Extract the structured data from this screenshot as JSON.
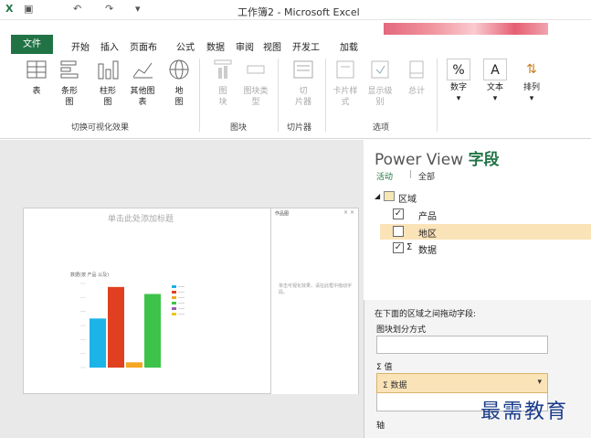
{
  "title": "工作簿2 - Microsoft Excel",
  "tabs": [
    "文件",
    "开始",
    "插入",
    "页面布",
    "公式",
    "数据",
    "审阅",
    "视图",
    "开发工",
    "加载"
  ],
  "ribbon": {
    "switch_group": {
      "label": "切换可视化效果",
      "buttons": [
        {
          "name": "table",
          "label": "表"
        },
        {
          "name": "bar",
          "label": "条形\n图"
        },
        {
          "name": "column",
          "label": "柱形\n图"
        },
        {
          "name": "other",
          "label": "其他图\n表"
        },
        {
          "name": "map",
          "label": "地\n图"
        }
      ]
    },
    "tiles_group": {
      "label": "图块",
      "buttons": [
        {
          "name": "tiles",
          "label": "图\n块"
        },
        {
          "name": "tile_type",
          "label": "图块类\n型"
        }
      ]
    },
    "slicer_group": {
      "label": "切片器",
      "buttons": [
        {
          "name": "slicer",
          "label": "切\n片器"
        }
      ]
    },
    "options_group": {
      "label": "选项",
      "buttons": [
        {
          "name": "card",
          "label": "卡片样\n式"
        },
        {
          "name": "show_level",
          "label": "显示级\n别"
        },
        {
          "name": "total",
          "label": "总计"
        }
      ]
    },
    "format_buttons": [
      {
        "name": "number",
        "icon": "%",
        "label": "数字"
      },
      {
        "name": "text",
        "icon": "A",
        "label": "文本"
      },
      {
        "name": "sort",
        "icon": "⇅",
        "label": "排列"
      }
    ]
  },
  "canvas": {
    "sheet_title_placeholder": "单击此处添加标题",
    "filters_title": "作品图",
    "filters_hint": "单击可视化效果，请在此框中拖动字段。",
    "chart_title": "数据(按 产品 以及)"
  },
  "chart_data": {
    "type": "bar",
    "categories": [
      "A",
      "B",
      "C",
      "D"
    ],
    "values": [
      1400,
      2300,
      150,
      2100
    ],
    "ylim": [
      0,
      2400
    ],
    "colors": [
      "#1bb3e8",
      "#e0401f",
      "#f5a623",
      "#3dc34a"
    ],
    "legend_colors": [
      "#1bb3e8",
      "#e0401f",
      "#f5a623",
      "#3dc34a",
      "#9b59b6",
      "#f1c40f"
    ]
  },
  "pane": {
    "title_a": "Power View ",
    "title_b": "字段",
    "tab_active": "活动",
    "tab_all": "全部",
    "table_name": "区域",
    "fields": [
      {
        "label": "产品",
        "checked": true,
        "sum": false
      },
      {
        "label": "地区",
        "checked": false,
        "sum": false
      },
      {
        "label": "数据",
        "checked": true,
        "sum": true
      }
    ],
    "drag_hint": "在下面的区域之间拖动字段:",
    "tile_by": "图块划分方式",
    "values_label": "Σ 值",
    "values_item": "Σ 数据",
    "axis_label": "轴"
  },
  "watermark": "最需教育"
}
